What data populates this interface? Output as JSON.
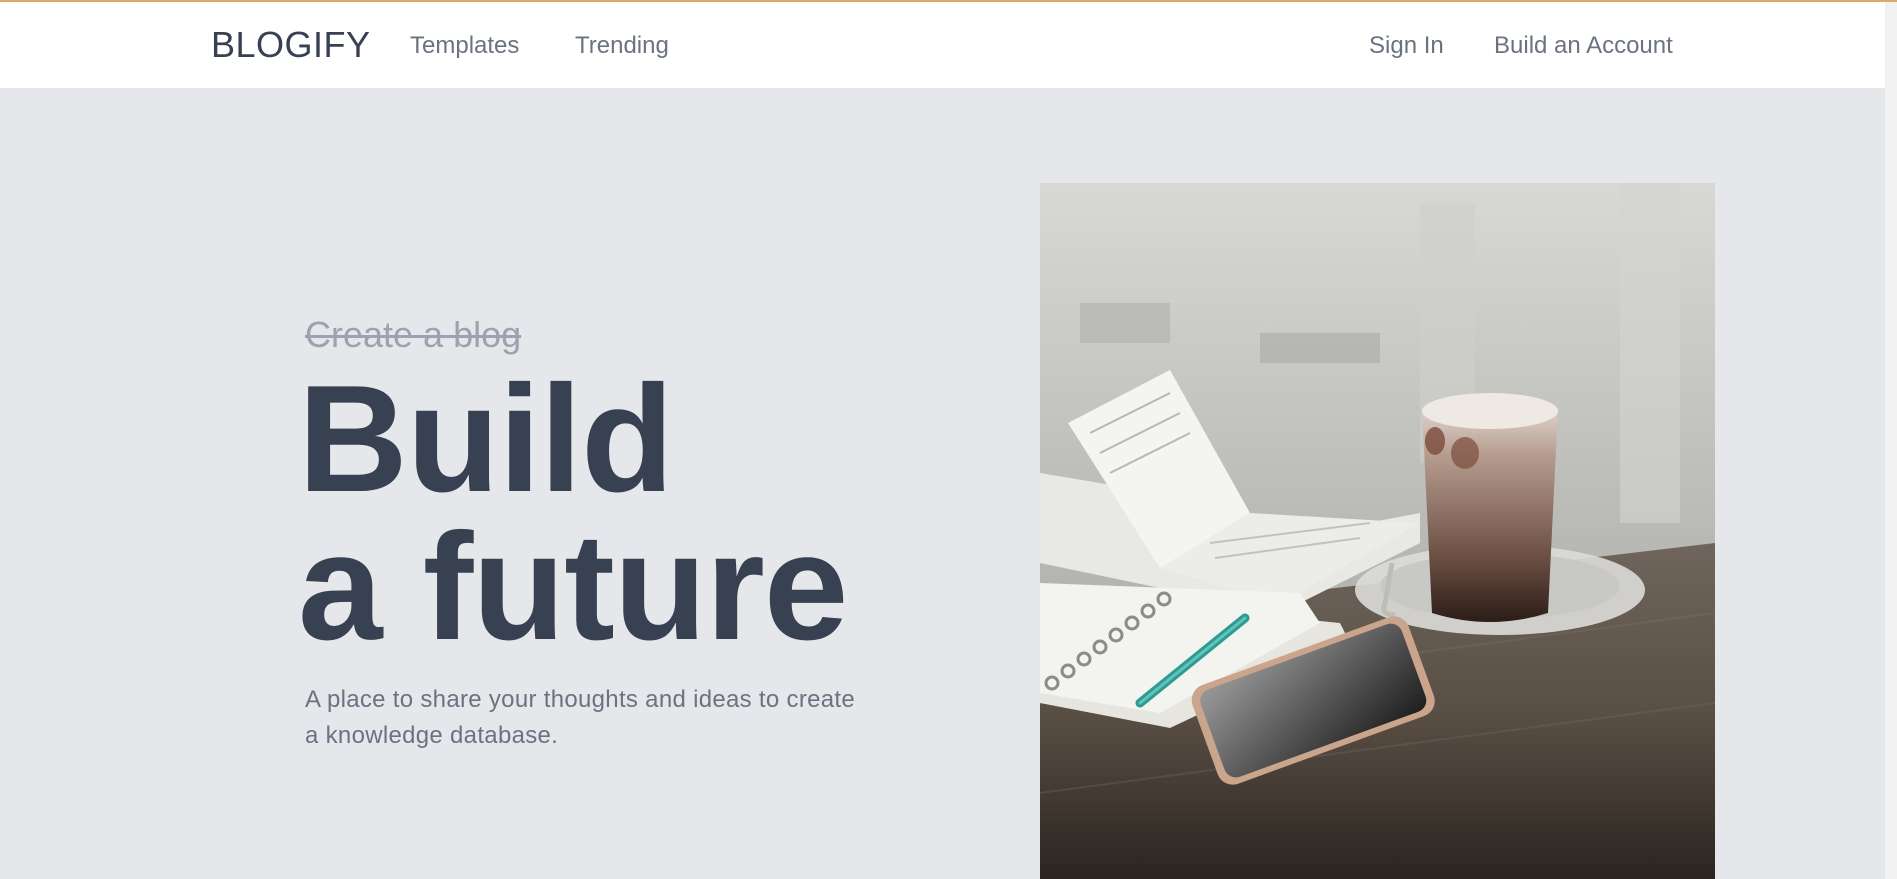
{
  "header": {
    "brand": "BLOGIFY",
    "nav_links": [
      {
        "label": "Templates"
      },
      {
        "label": "Trending"
      }
    ],
    "sign_in": "Sign In",
    "build_account": "Build an Account"
  },
  "hero": {
    "strikethrough_text": "Create a blog",
    "headline_line1": "Build",
    "headline_line2": "a future",
    "description": "A place to share your thoughts and ideas to create a knowledge database."
  },
  "colors": {
    "page_background": "#e5e7eb",
    "heading_text": "#374151",
    "muted_text": "#6b7280",
    "strike_text": "#9ca3af",
    "top_accent_line": "#d9a86a"
  }
}
